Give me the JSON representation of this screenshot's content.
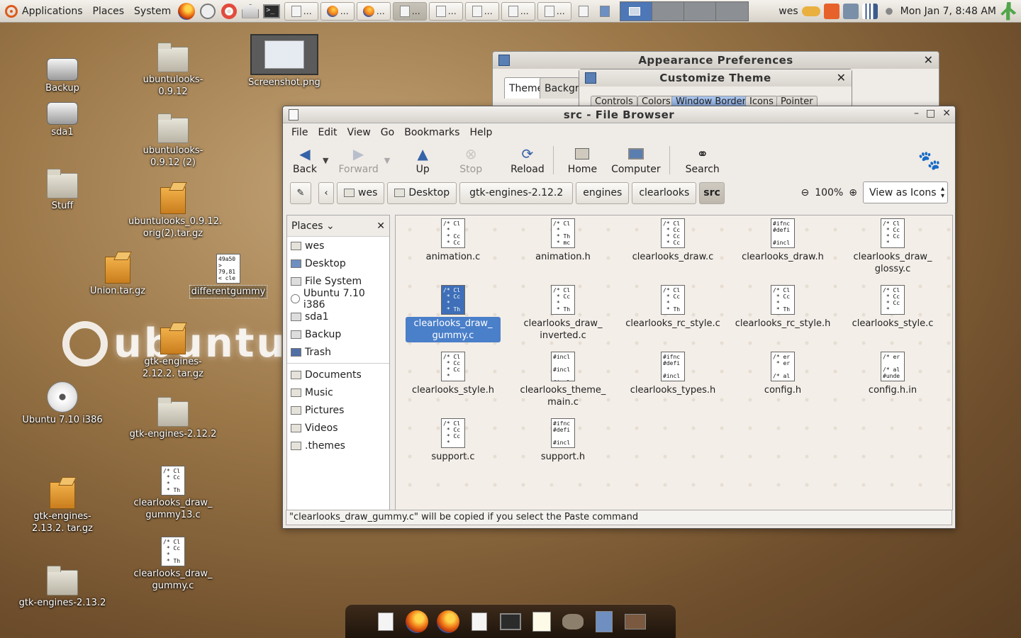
{
  "top_panel": {
    "menus": [
      "Applications",
      "Places",
      "System"
    ],
    "launchers": [
      "firefox-icon",
      "clock-icon",
      "help-ring-icon",
      "home-folder-icon",
      "terminal-icon"
    ],
    "tasks_count_hint": "",
    "user": "wes",
    "clock": "Mon Jan  7,  8:48 AM"
  },
  "desktop": {
    "icons": [
      {
        "label": "Backup",
        "kind": "drive"
      },
      {
        "label": "sda1",
        "kind": "drive"
      },
      {
        "label": "Stuff",
        "kind": "folder"
      },
      {
        "label": "ubuntulooks-0.9.12",
        "kind": "folder"
      },
      {
        "label": "ubuntulooks-0.9.12 (2)",
        "kind": "folder"
      },
      {
        "label": "ubuntulooks_0.9.12. orig(2).tar.gz",
        "kind": "archive"
      },
      {
        "label": "Screenshot.png",
        "kind": "image"
      },
      {
        "label": "Union.tar.gz",
        "kind": "archive"
      },
      {
        "label": "differentgummy",
        "kind": "text"
      },
      {
        "label": "gtk-engines-2.12.2. tar.gz",
        "kind": "archive"
      },
      {
        "label": "Ubuntu 7.10 i386",
        "kind": "cdrom"
      },
      {
        "label": "gtk-engines-2.12.2",
        "kind": "folder"
      },
      {
        "label": "clearlooks_draw_ gummy13.c",
        "kind": "c-file"
      },
      {
        "label": "gtk-engines-2.13.2. tar.gz",
        "kind": "archive"
      },
      {
        "label": "clearlooks_draw_ gummy.c",
        "kind": "c-file"
      },
      {
        "label": "gtk-engines-2.13.2",
        "kind": "folder"
      }
    ],
    "wordmark": "ubuntu"
  },
  "appearance_window": {
    "title": "Appearance Preferences",
    "tabs": [
      "Theme",
      "Backgr"
    ]
  },
  "customize_window": {
    "title": "Customize Theme",
    "tabs": [
      "Controls",
      "Colors",
      "Window Border",
      "Icons",
      "Pointer"
    ]
  },
  "file_browser": {
    "title": "src - File Browser",
    "menu": [
      "File",
      "Edit",
      "View",
      "Go",
      "Bookmarks",
      "Help"
    ],
    "toolbar": {
      "back": "Back",
      "forward": "Forward",
      "up": "Up",
      "stop": "Stop",
      "reload": "Reload",
      "home": "Home",
      "computer": "Computer",
      "search": "Search"
    },
    "breadcrumbs": [
      "wes",
      "Desktop",
      "gtk-engines-2.12.2",
      "engines",
      "clearlooks",
      "src"
    ],
    "zoom": "100%",
    "view_mode": "View as Icons",
    "sidebar_title": "Places",
    "places": [
      "wes",
      "Desktop",
      "File System",
      "Ubuntu 7.10 i386",
      "sda1",
      "Backup",
      "Trash"
    ],
    "bookmarks": [
      "Documents",
      "Music",
      "Pictures",
      "Videos",
      ".themes"
    ],
    "files": [
      {
        "name": "animation.c",
        "preview": "/* Cl\n *\n * Cc\n * Cc"
      },
      {
        "name": "animation.h",
        "preview": "/* Cl\n *\n * Th\n * mc"
      },
      {
        "name": "clearlooks_draw.c",
        "preview": "/* Cl\n * Cc\n * Cc\n * Cc"
      },
      {
        "name": "clearlooks_draw.h",
        "preview": "#ifnc\n#defi\n\n#incl"
      },
      {
        "name": "clearlooks_draw_ glossy.c",
        "preview": "/* Cl\n * Cc\n * Cc\n *"
      },
      {
        "name": "clearlooks_draw_ gummy.c",
        "preview": "/* Cl\n * Cc\n *\n * Th",
        "selected": true
      },
      {
        "name": "clearlooks_draw_ inverted.c",
        "preview": "/* Cl\n * Cc\n *\n * Th"
      },
      {
        "name": "clearlooks_rc_style.c",
        "preview": "/* Cl\n * Cc\n *\n * Th"
      },
      {
        "name": "clearlooks_rc_style.h",
        "preview": "/* Cl\n * Cc\n *\n * Th"
      },
      {
        "name": "clearlooks_style.c",
        "preview": "/* Cl\n * Cc\n * Cc\n *"
      },
      {
        "name": "clearlooks_style.h",
        "preview": "/* Cl\n * Cc\n * Cc\n *"
      },
      {
        "name": "clearlooks_theme_ main.c",
        "preview": "#incl\n\n#incl\n\n#incl"
      },
      {
        "name": "clearlooks_types.h",
        "preview": "#ifnc\n#defi\n\n#incl"
      },
      {
        "name": "config.h",
        "preview": "/* er\n * er\n\n/* al"
      },
      {
        "name": "config.h.in",
        "preview": "/* er\n\n/* al\n#unde"
      },
      {
        "name": "support.c",
        "preview": "/* Cl\n * Cc\n * Cc\n *"
      },
      {
        "name": "support.h",
        "preview": "#ifnc\n#defi\n\n#incl"
      }
    ],
    "status": "\"clearlooks_draw_gummy.c\" will be copied if you select the Paste command"
  },
  "dock": {
    "items": [
      "file-manager-icon",
      "firefox-icon",
      "firefox-icon",
      "file-manager-icon",
      "terminal-icon",
      "text-editor-icon",
      "gimp-icon",
      "folders-icon",
      "image-viewer-icon"
    ]
  },
  "colors": {
    "selection": "#4a7fc9",
    "panel": "#d8d3c9",
    "desktop": "#9b7748"
  }
}
